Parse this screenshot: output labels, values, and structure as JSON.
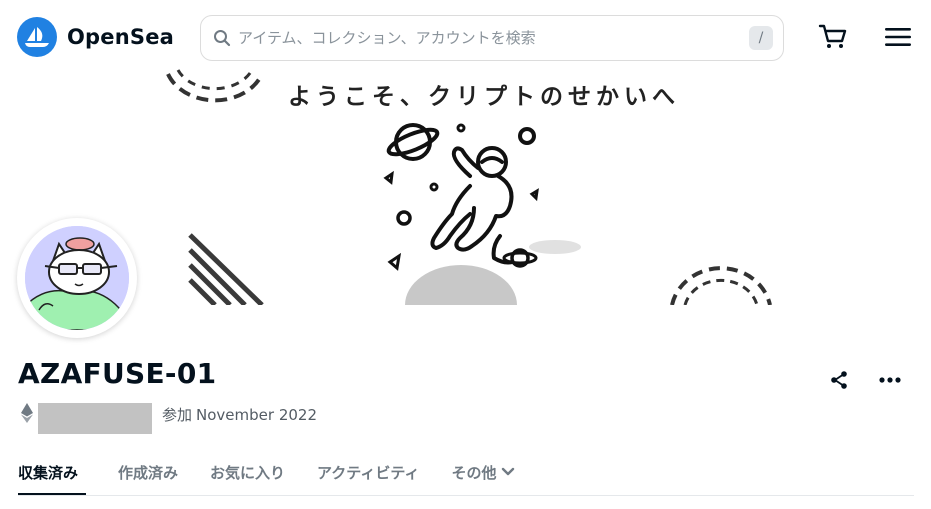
{
  "header": {
    "brand": "OpenSea",
    "search": {
      "placeholder": "アイテム、コレクション、アカウントを検索",
      "value": "",
      "shortcut_hint": "/"
    },
    "icons": {
      "logo": "opensea-boat-icon",
      "search": "search-icon",
      "cart": "cart-icon",
      "menu": "hamburger-menu-icon"
    }
  },
  "banner": {
    "text": "ようこそ、クリプトのせかいへ"
  },
  "profile": {
    "name": "AZAFUSE-01",
    "chain_icon": "ethereum-icon",
    "address": "",
    "joined_label": "参加",
    "joined_date": "November 2022",
    "actions": {
      "share": "share-icon",
      "more": "more-dots-icon"
    }
  },
  "tabs": [
    {
      "label": "収集済み",
      "active": true
    },
    {
      "label": "作成済み",
      "active": false
    },
    {
      "label": "お気に入り",
      "active": false
    },
    {
      "label": "アクティビティ",
      "active": false
    },
    {
      "label": "その他",
      "active": false,
      "has_dropdown": true
    }
  ],
  "colors": {
    "brand_blue": "#2081e2",
    "text_primary": "#04111d",
    "text_secondary": "#707a83",
    "avatar_bg": "#cfd0ff",
    "redaction_gray": "#c2c2c2"
  }
}
